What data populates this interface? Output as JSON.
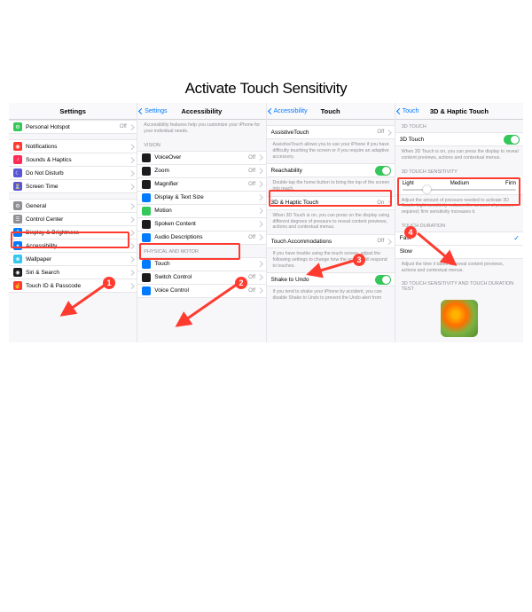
{
  "title": "Activate Touch Sensitivity",
  "pane1": {
    "nav_title": "Settings",
    "items": [
      {
        "label": "Personal Hotspot",
        "value": "Off",
        "icon": "#34c759",
        "glyph": "⚙"
      },
      {
        "label": "Notifications",
        "icon": "#ff3b30",
        "glyph": "◉"
      },
      {
        "label": "Sounds & Haptics",
        "icon": "#ff2d55",
        "glyph": "♪"
      },
      {
        "label": "Do Not Disturb",
        "icon": "#5856d6",
        "glyph": "☾"
      },
      {
        "label": "Screen Time",
        "icon": "#5856d6",
        "glyph": "⏳"
      },
      {
        "label": "General",
        "icon": "#8e8e93",
        "glyph": "⚙"
      },
      {
        "label": "Control Center",
        "icon": "#8e8e93",
        "glyph": "☰"
      },
      {
        "label": "Display & Brightness",
        "icon": "#007aff",
        "glyph": "A"
      },
      {
        "label": "Accessibility",
        "icon": "#007aff",
        "glyph": "✦"
      },
      {
        "label": "Wallpaper",
        "icon": "#34c7ee",
        "glyph": "❀"
      },
      {
        "label": "Siri & Search",
        "icon": "#1c1c1e",
        "glyph": "◉"
      },
      {
        "label": "Touch ID & Passcode",
        "icon": "#ff3b30",
        "glyph": "☝"
      }
    ]
  },
  "pane2": {
    "nav_back": "Settings",
    "nav_title": "Accessibility",
    "intro": "Accessibility features help you customize your iPhone for your individual needs.",
    "group1": "VISION",
    "vision": [
      {
        "label": "VoiceOver",
        "value": "Off",
        "icon": "#1c1c1e"
      },
      {
        "label": "Zoom",
        "value": "Off",
        "icon": "#1c1c1e"
      },
      {
        "label": "Magnifier",
        "value": "Off",
        "icon": "#1c1c1e"
      },
      {
        "label": "Display & Text Size",
        "icon": "#007aff"
      },
      {
        "label": "Motion",
        "icon": "#34c759"
      },
      {
        "label": "Spoken Content",
        "icon": "#1c1c1e"
      },
      {
        "label": "Audio Descriptions",
        "value": "Off",
        "icon": "#007aff"
      }
    ],
    "group2": "PHYSICAL AND MOTOR",
    "motor": [
      {
        "label": "Touch",
        "icon": "#007aff"
      },
      {
        "label": "Switch Control",
        "value": "Off",
        "icon": "#1c1c1e"
      },
      {
        "label": "Voice Control",
        "value": "Off",
        "icon": "#007aff"
      }
    ]
  },
  "pane3": {
    "nav_back": "Accessibility",
    "nav_title": "Touch",
    "rows": {
      "assistive": {
        "label": "AssistiveTouch",
        "value": "Off",
        "foot": "AssistiveTouch allows you to use your iPhone if you have difficulty touching the screen or if you require an adaptive accessory."
      },
      "reach": {
        "label": "Reachability",
        "foot": "Double-tap the home button to bring the top of the screen into reach."
      },
      "haptic": {
        "label": "3D & Haptic Touch",
        "value": "On",
        "foot": "When 3D Touch is on, you can press on the display using different degrees of pressure to reveal content previews, actions and contextual menus."
      },
      "accom": {
        "label": "Touch Accommodations",
        "value": "Off",
        "foot": "If you have trouble using the touch screen, adjust the following settings to change how the screen will respond to touches."
      },
      "shake": {
        "label": "Shake to Undo",
        "foot": "If you tend to shake your iPhone by accident, you can disable Shake to Undo to prevent the Undo alert from"
      }
    }
  },
  "pane4": {
    "nav_back": "Touch",
    "nav_title": "3D & Haptic Touch",
    "g1": "3D TOUCH",
    "row1": {
      "label": "3D Touch",
      "foot": "When 3D Touch is on, you can press the display to reveal content previews, actions and contextual menus."
    },
    "g2": "3D TOUCH SENSITIVITY",
    "slider": {
      "l": "Light",
      "m": "Medium",
      "r": "Firm",
      "foot": "Adjust the amount of pressure needed to activate 3D Touch. Light sensitivity reduces the amount of pressure required; firm sensitivity increases it."
    },
    "g3": "TOUCH DURATION",
    "fast": "Fast",
    "slow": "Slow",
    "dur_foot": "Adjust the time it takes to reveal content previews, actions and contextual menus.",
    "g4": "3D TOUCH SENSITIVITY AND TOUCH DURATION TEST"
  },
  "badges": [
    "1",
    "2",
    "3",
    "4"
  ]
}
